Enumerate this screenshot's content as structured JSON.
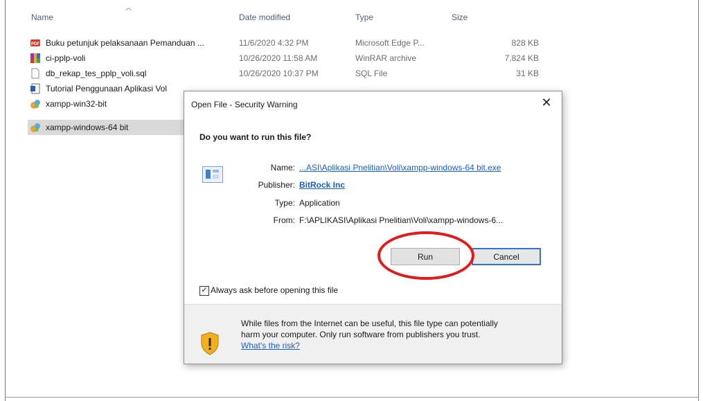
{
  "explorer": {
    "columns": {
      "name": "Name",
      "date": "Date modified",
      "type": "Type",
      "size": "Size"
    },
    "files": [
      {
        "name": "Buku petunjuk pelaksanaan Pemanduan ...",
        "date": "11/6/2020 4:32 PM",
        "type": "Microsoft Edge P...",
        "size": "828 KB",
        "icon": "pdf-icon"
      },
      {
        "name": "ci-pplp-voli",
        "date": "10/26/2020 11:58 AM",
        "type": "WinRAR archive",
        "size": "7,824 KB",
        "icon": "winrar-icon"
      },
      {
        "name": "db_rekap_tes_pplp_voli.sql",
        "date": "10/26/2020 10:37 PM",
        "type": "SQL File",
        "size": "31 KB",
        "icon": "file-icon"
      },
      {
        "name": "Tutorial Penggunaan Aplikasi Vol",
        "date": "",
        "type": "",
        "size": "",
        "icon": "document-icon"
      },
      {
        "name": "xampp-win32-bit",
        "date": "",
        "type": "",
        "size": "",
        "icon": "installer-icon"
      },
      {
        "name": "xampp-windows-64 bit",
        "date": "",
        "type": "",
        "size": "",
        "icon": "installer-icon",
        "selected": true
      }
    ]
  },
  "dialog": {
    "title": "Open File - Security Warning",
    "close": "✕",
    "question": "Do you want to run this file?",
    "name_label": "Name:",
    "name_value": "...ASI\\Aplikasi Pnelitian\\Voli\\xampp-windows-64 bit.exe",
    "publisher_label": "Publisher:",
    "publisher_value": "BitRock Inc",
    "type_label": "Type:",
    "type_value": "Application",
    "from_label": "From:",
    "from_value": "F:\\APLIKASI\\Aplikasi Pnelitian\\Voli\\xampp-windows-6...",
    "run_label": "Run",
    "cancel_label": "Cancel",
    "checkbox_label": "Always ask before opening this file",
    "checkbox_checked": true,
    "warning_line1": "While files from the Internet can be useful, this file type can potentially",
    "warning_line2": "harm your computer. Only run software from publishers you trust.",
    "risk_link": "What's the risk?"
  },
  "colors": {
    "highlight_circle": "#e01b1b",
    "link": "#1a5fc7",
    "default_button_border": "#2f73d8"
  }
}
